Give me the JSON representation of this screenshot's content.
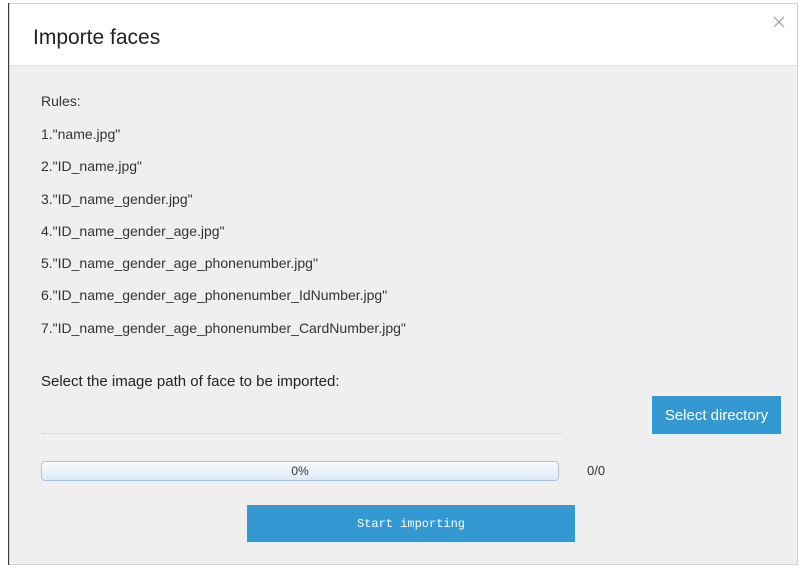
{
  "dialog": {
    "title": "Importe faces",
    "close_icon": "close-icon"
  },
  "rules": {
    "heading": "Rules:",
    "items": [
      "1.\"name.jpg\"",
      "2.\"ID_name.jpg\"",
      "3.\"ID_name_gender.jpg\"",
      "4.\"ID_name_gender_age.jpg\"",
      "5.\"ID_name_gender_age_phonenumber.jpg\"",
      "6.\"ID_name_gender_age_phonenumber_IdNumber.jpg\"",
      "7.\"ID_name_gender_age_phonenumber_CardNumber.jpg\""
    ]
  },
  "path_selector": {
    "label": "Select the image path of face to be imported:",
    "path_value": "",
    "button_label": "Select directory"
  },
  "progress": {
    "percent_label": "0%",
    "fraction": 0,
    "count_label": "0/0"
  },
  "actions": {
    "start_label": "Start importing"
  },
  "colors": {
    "accent": "#3498d2",
    "dialog_background": "#efefef",
    "header_background": "#ffffff"
  }
}
